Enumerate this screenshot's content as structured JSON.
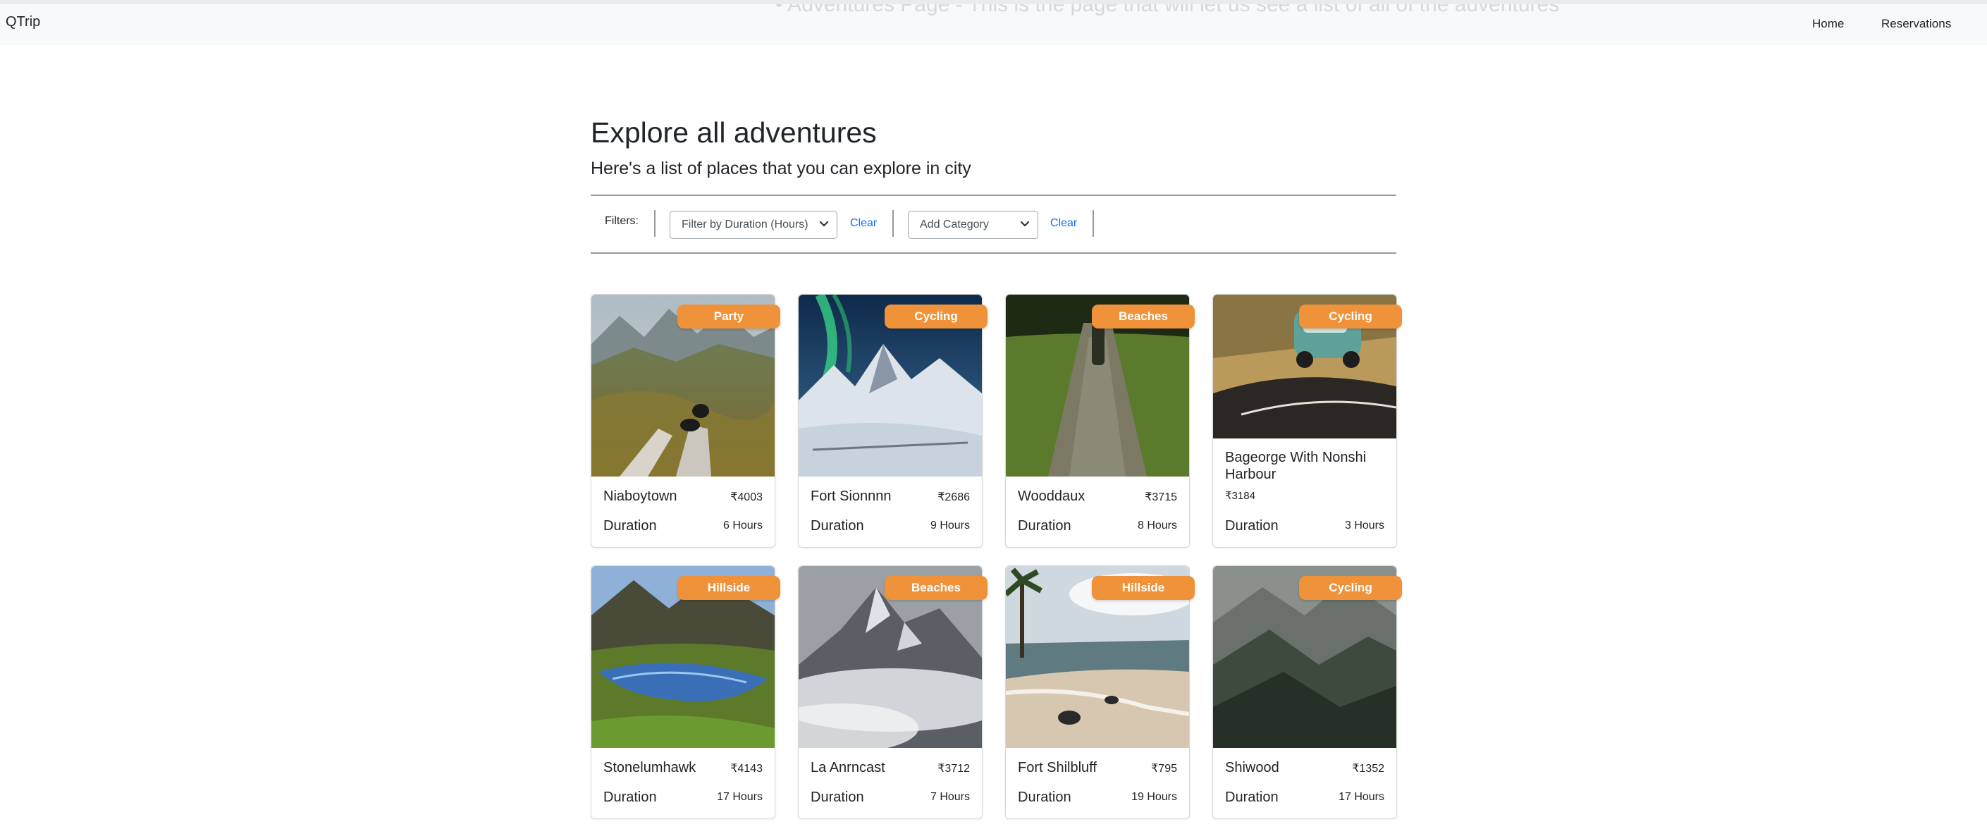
{
  "navbar": {
    "brand": "QTrip",
    "ghost_text": "• Adventures Page - This is the page that will let us see a list of all of the adventures",
    "home": "Home",
    "reservations": "Reservations"
  },
  "header": {
    "title": "Explore all adventures",
    "subtitle": "Here's a list of places that you can explore in city"
  },
  "filters": {
    "label": "Filters:",
    "duration_select": "Filter by Duration (Hours)",
    "category_select": "Add Category",
    "clear_label": "Clear"
  },
  "duration_label": "Duration",
  "colors": {
    "banner": "#f0923a",
    "link": "#0d6efd",
    "navbar": "#f8f9fa"
  },
  "adventures": [
    {
      "name": "Niaboytown",
      "price": "₹4003",
      "category": "Party",
      "duration": "6 Hours"
    },
    {
      "name": "Fort Sionnnn",
      "price": "₹2686",
      "category": "Cycling",
      "duration": "9 Hours"
    },
    {
      "name": "Wooddaux",
      "price": "₹3715",
      "category": "Beaches",
      "duration": "8 Hours"
    },
    {
      "name": "Bageorge With Nonshi Harbour",
      "price": "₹3184",
      "category": "Cycling",
      "duration": "3 Hours"
    },
    {
      "name": "Stonelumhawk",
      "price": "₹4143",
      "category": "Hillside",
      "duration": "17 Hours"
    },
    {
      "name": "La Anrncast",
      "price": "₹3712",
      "category": "Beaches",
      "duration": "7 Hours"
    },
    {
      "name": "Fort Shilbluff",
      "price": "₹795",
      "category": "Hillside",
      "duration": "19 Hours"
    },
    {
      "name": "Shiwood",
      "price": "₹1352",
      "category": "Cycling",
      "duration": "17 Hours"
    }
  ]
}
